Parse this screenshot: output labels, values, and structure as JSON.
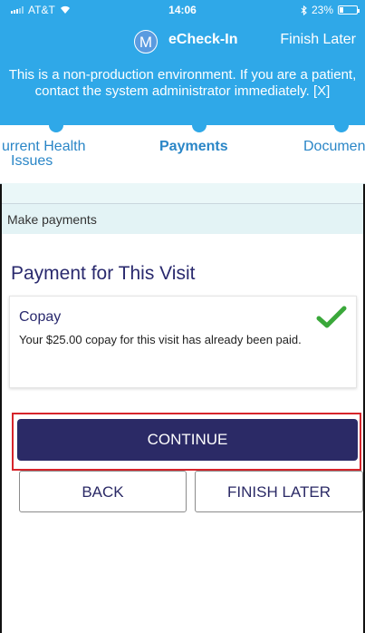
{
  "status_bar": {
    "carrier": "AT&T",
    "time": "14:06",
    "battery": "23%"
  },
  "header": {
    "avatar_letter": "M",
    "title": "eCheck-In",
    "finish_later": "Finish Later"
  },
  "banner": {
    "text": "This is a non-production environment. If you are a patient, contact the system administrator immediately. [X]"
  },
  "steps": [
    {
      "label_line1": "urrent Health",
      "label_line2": "Issues"
    },
    {
      "label_line1": "Payments",
      "label_line2": ""
    },
    {
      "label_line1": "Documen",
      "label_line2": ""
    }
  ],
  "section": {
    "title": "Make payments"
  },
  "page": {
    "title": "Payment for This Visit"
  },
  "card": {
    "name": "Copay",
    "description": "Your $25.00 copay for this visit has already been paid."
  },
  "buttons": {
    "continue": "CONTINUE",
    "back": "BACK",
    "finish_later": "FINISH LATER"
  },
  "colors": {
    "header_bg": "#2fa8e8",
    "primary_button": "#2b2a66",
    "highlight": "#d6252b",
    "check": "#3aa83a"
  },
  "icons": {
    "check": "checkmark-icon",
    "signal": "signal-icon",
    "wifi": "wifi-icon",
    "bluetooth": "bluetooth-icon",
    "battery": "battery-icon"
  }
}
